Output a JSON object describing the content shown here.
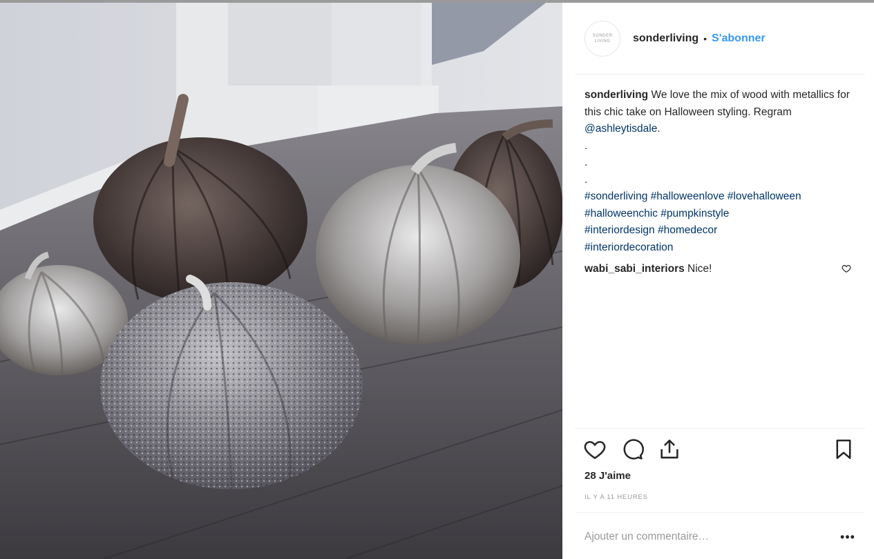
{
  "post": {
    "username": "sonderliving",
    "dot": "•",
    "follow_label": "S'abonner",
    "avatar_text": "SONDER LIVING"
  },
  "caption": {
    "username": "sonderliving",
    "text": "We love the mix of wood with metallics for this chic take on Halloween styling. Regram",
    "mention": "@ashleytisdale",
    "after_mention": ".",
    "line1": ".",
    "line2": ".",
    "line3": ".",
    "hashtags_1": "#sonderliving #halloweenlove #lovehalloween",
    "hashtags_2": "#halloweenchic #pumpkinstyle",
    "hashtags_3": "#interiordesign #homedecor",
    "hashtags_4": "#interiordecoration"
  },
  "comment": {
    "username": "wabi_sabi_interiors",
    "text": "Nice!"
  },
  "likes": "28 J'aime",
  "timestamp": "IL Y A 11 HEURES",
  "add_comment_placeholder": "Ajouter un commentaire…",
  "more_label": "•••",
  "icons": {
    "like": "heart-icon",
    "comment": "comment-icon",
    "share": "share-icon",
    "save": "bookmark-icon",
    "comment_like": "small-heart-icon"
  },
  "colors": {
    "link": "#3897f0",
    "hashtag": "#003569",
    "text": "#262626",
    "muted": "#999999"
  }
}
